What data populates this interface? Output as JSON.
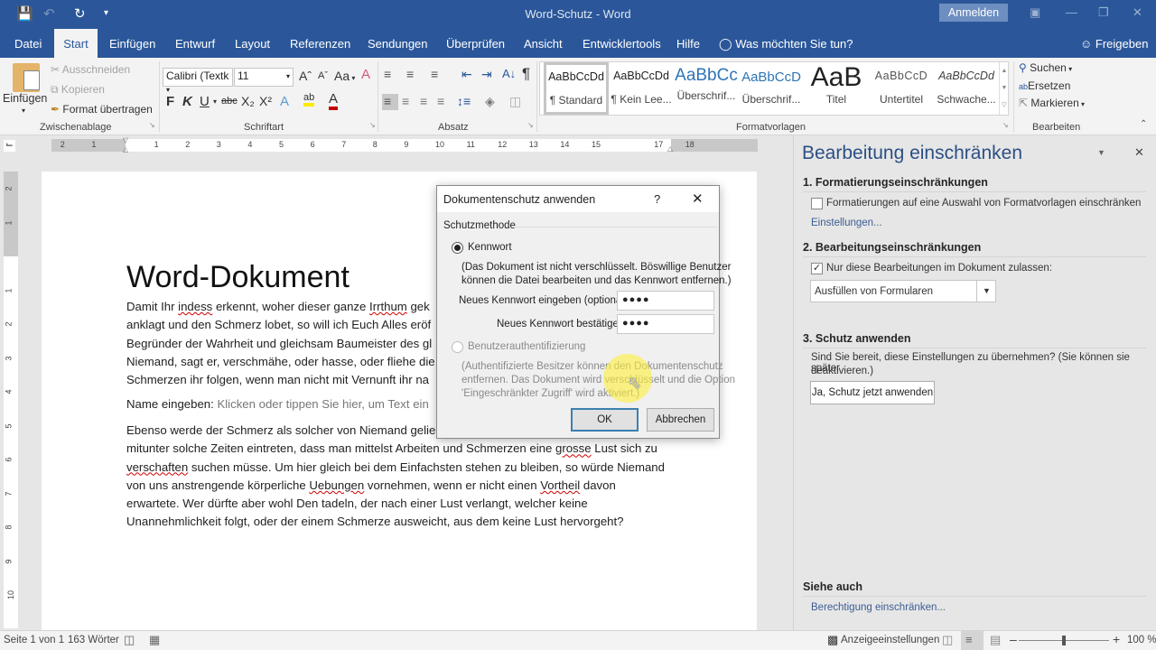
{
  "window": {
    "title": "Word-Schutz  -  Word",
    "signin": "Anmelden",
    "quick_access": {
      "save_icon": "save-icon",
      "undo_icon": "undo-icon",
      "redo_icon": "redo-icon",
      "customize_icon": "customize-qat-icon"
    }
  },
  "tabs": [
    {
      "label": "Datei"
    },
    {
      "label": "Start",
      "active": true
    },
    {
      "label": "Einfügen"
    },
    {
      "label": "Entwurf"
    },
    {
      "label": "Layout"
    },
    {
      "label": "Referenzen"
    },
    {
      "label": "Sendungen"
    },
    {
      "label": "Überprüfen"
    },
    {
      "label": "Ansicht"
    },
    {
      "label": "Entwicklertools"
    },
    {
      "label": "Hilfe"
    }
  ],
  "tell_me": "Was möchten Sie tun?",
  "share": "Freigeben",
  "ribbon": {
    "clipboard": {
      "paste": "Einfügen",
      "cut": "Ausschneiden",
      "copy": "Kopieren",
      "format_painter": "Format übertragen",
      "label": "Zwischenablage"
    },
    "font": {
      "name": "Calibri (Textk",
      "size": "11",
      "change_case": "Aa",
      "bold": "F",
      "italic": "K",
      "underline": "U",
      "strike": "abc",
      "subscript": "X₂",
      "superscript": "X²",
      "label": "Schriftart"
    },
    "paragraph": {
      "label": "Absatz",
      "pilcrow": "¶"
    },
    "styles": {
      "label": "Formatvorlagen",
      "items": [
        {
          "preview": "AaBbCcDd",
          "name": "¶ Standard"
        },
        {
          "preview": "AaBbCcDd",
          "name": "¶ Kein Lee..."
        },
        {
          "preview": "AaBbCc",
          "name": "Überschrif..."
        },
        {
          "preview": "AaBbCcD",
          "name": "Überschrif..."
        },
        {
          "preview": "AaB",
          "name": "Titel"
        },
        {
          "preview": "AaBbCcD",
          "name": "Untertitel"
        },
        {
          "preview": "AaBbCcDd",
          "name": "Schwache..."
        }
      ]
    },
    "editing": {
      "find": "Suchen",
      "replace": "Ersetzen",
      "select": "Markieren",
      "label": "Bearbeiten"
    }
  },
  "ruler": {
    "h_left": [
      "2",
      "1"
    ],
    "h_main": [
      "1",
      "2",
      "3",
      "4",
      "5",
      "6",
      "7",
      "8",
      "9",
      "10",
      "11",
      "12",
      "13",
      "14",
      "15"
    ],
    "h_right": [
      "17",
      "18"
    ],
    "v_grey": [
      "2",
      "1"
    ],
    "v_main": [
      "1",
      "2",
      "3",
      "4",
      "5",
      "6",
      "7",
      "8",
      "9",
      "10"
    ]
  },
  "document": {
    "title": "Word-Dokument",
    "p1": {
      "l1a": "Damit Ihr ",
      "l1b": "indess",
      "l1c": " erkennt, woher dieser ganze ",
      "l1d": "Irrthum",
      "l1e": " gek",
      "l2": "anklagt und den Schmerz lobet, so will ich Euch Alles eröf",
      "l3": "Begründer der Wahrheit und gleichsam Baumeister des gl",
      "l4": "Niemand, sagt er, verschmähe, oder hasse, oder fliehe die",
      "l5": "Schmerzen ihr folgen, wenn man nicht mit Vernunft ihr na"
    },
    "name_label": "Name eingeben: ",
    "name_placeholder": "Klicken oder tippen Sie hier, um Text ein",
    "p2": {
      "l1": "Ebenso werde der Schmerz als solcher von Niemand gelie",
      "l2a": "mitunter solche Zeiten eintreten, dass man mittelst Arbeiten und Schmerzen eine ",
      "l2b": "grosse",
      "l2c": " Lust sich zu",
      "l3a": "verschaften",
      "l3b": " suchen müsse. Um hier gleich bei dem Einfachsten stehen zu bleiben, so würde Niemand",
      "l4a": "von uns anstrengende körperliche ",
      "l4b": "Uebungen",
      "l4c": " vornehmen, wenn er nicht einen ",
      "l4d": "Vortheil",
      "l4e": " davon",
      "l5": "erwartete. Wer dürfte aber wohl Den tadeln, der nach einer Lust verlangt, welcher keine",
      "l6": "Unannehmlichkeit folgt, oder der einem Schmerze ausweicht, aus dem keine Lust hervorgeht?"
    }
  },
  "pane": {
    "title": "Bearbeitung einschränken",
    "s1_heading": "1. Formatierungseinschränkungen",
    "s1_checkbox": "Formatierungen auf eine Auswahl von Formatvorlagen einschränken",
    "s1_checked": false,
    "s1_link": "Einstellungen...",
    "s2_heading": "2. Bearbeitungseinschränkungen",
    "s2_checkbox": "Nur diese Bearbeitungen im Dokument zulassen:",
    "s2_checked": true,
    "s2_select": "Ausfüllen von Formularen",
    "s3_heading": "3. Schutz anwenden",
    "s3_text1": "Sind Sie bereit, diese Einstellungen zu übernehmen? (Sie können sie später",
    "s3_text2": "deaktivieren.)",
    "s3_button": "Ja, Schutz jetzt anwenden",
    "see_also_heading": "Siehe auch",
    "see_also_link": "Berechtigung einschränken..."
  },
  "dialog": {
    "title": "Dokumentenschutz anwenden",
    "help": "?",
    "group_label": "Schutzmethode",
    "opt_password": "Kennwort",
    "opt_password_desc1": "(Das Dokument ist nicht verschlüsselt. Böswillige Benutzer",
    "opt_password_desc2": "können die Datei bearbeiten und das Kennwort entfernen.)",
    "new_password_label": "Neues Kennwort eingeben (optional):",
    "new_password_value": "●●●●",
    "confirm_password_label": "Neues Kennwort bestätigen:",
    "confirm_password_value": "●●●●",
    "opt_auth": "Benutzerauthentifizierung",
    "opt_auth_desc1": "(Authentifizierte Besitzer können den Dokumentenschutz",
    "opt_auth_desc2": "entfernen. Das Dokument wird verschlüsselt und die Option",
    "opt_auth_desc3": "'Eingeschränkter Zugriff' wird aktiviert.)",
    "ok": "OK",
    "cancel": "Abbrechen"
  },
  "status": {
    "page": "Seite 1 von 1",
    "words": "163 Wörter",
    "display_settings": "Anzeigeeinstellungen",
    "zoom": "100 %",
    "zoom_level": 1.0
  }
}
